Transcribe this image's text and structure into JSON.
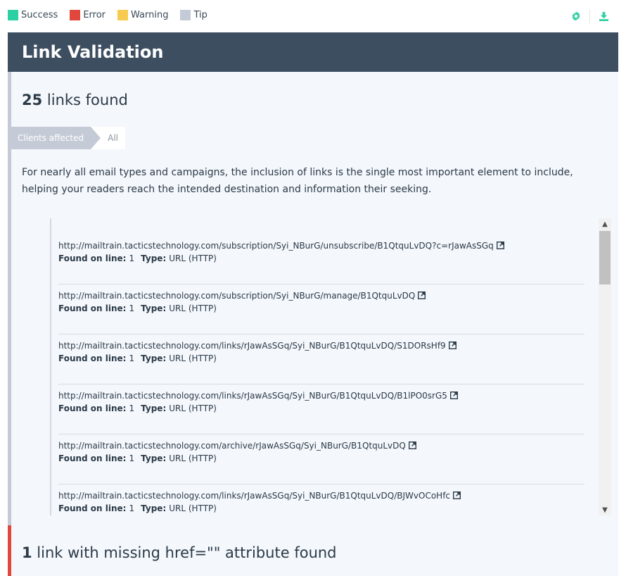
{
  "legend": [
    {
      "label": "Success",
      "color": "#2dd0a3"
    },
    {
      "label": "Error",
      "color": "#e2473d"
    },
    {
      "label": "Warning",
      "color": "#f7cb4f"
    },
    {
      "label": "Tip",
      "color": "#c5cbd6"
    }
  ],
  "toolbar": {
    "settings_icon": "gear-icon",
    "download_icon": "download-icon",
    "accent": "#2dd0a3"
  },
  "section": {
    "title": "Link Validation"
  },
  "links_panel": {
    "count": "25",
    "title_suffix": " links found",
    "clients_label": "Clients affected",
    "clients_value": "All",
    "description": "For nearly all email types and campaigns, the inclusion of links is the single most important element to include, helping your readers reach the intended destination and information their seeking.",
    "found_label": "Found on line:",
    "type_label": "Type:",
    "links": [
      {
        "url": "http://mailtrain.tacticstechnology.com/subscription/Syi_NBurG/unsubscribe/B1QtquLvDQ?c=rJawAsSGq",
        "line": "1",
        "type": "URL (HTTP)"
      },
      {
        "url": "http://mailtrain.tacticstechnology.com/subscription/Syi_NBurG/manage/B1QtquLvDQ",
        "line": "1",
        "type": "URL (HTTP)"
      },
      {
        "url": "http://mailtrain.tacticstechnology.com/links/rJawAsSGq/Syi_NBurG/B1QtquLvDQ/S1DORsHf9",
        "line": "1",
        "type": "URL (HTTP)"
      },
      {
        "url": "http://mailtrain.tacticstechnology.com/links/rJawAsSGq/Syi_NBurG/B1QtquLvDQ/B1lPO0srG5",
        "line": "1",
        "type": "URL (HTTP)"
      },
      {
        "url": "http://mailtrain.tacticstechnology.com/archive/rJawAsSGq/Syi_NBurG/B1QtquLvDQ",
        "line": "1",
        "type": "URL (HTTP)"
      },
      {
        "url": "http://mailtrain.tacticstechnology.com/links/rJawAsSGq/Syi_NBurG/B1QtquLvDQ/BJWvOCoHfc",
        "line": "1",
        "type": "URL (HTTP)"
      }
    ]
  },
  "href_panel": {
    "count": "1",
    "title_suffix": " link with missing href=\"\" attribute found"
  }
}
